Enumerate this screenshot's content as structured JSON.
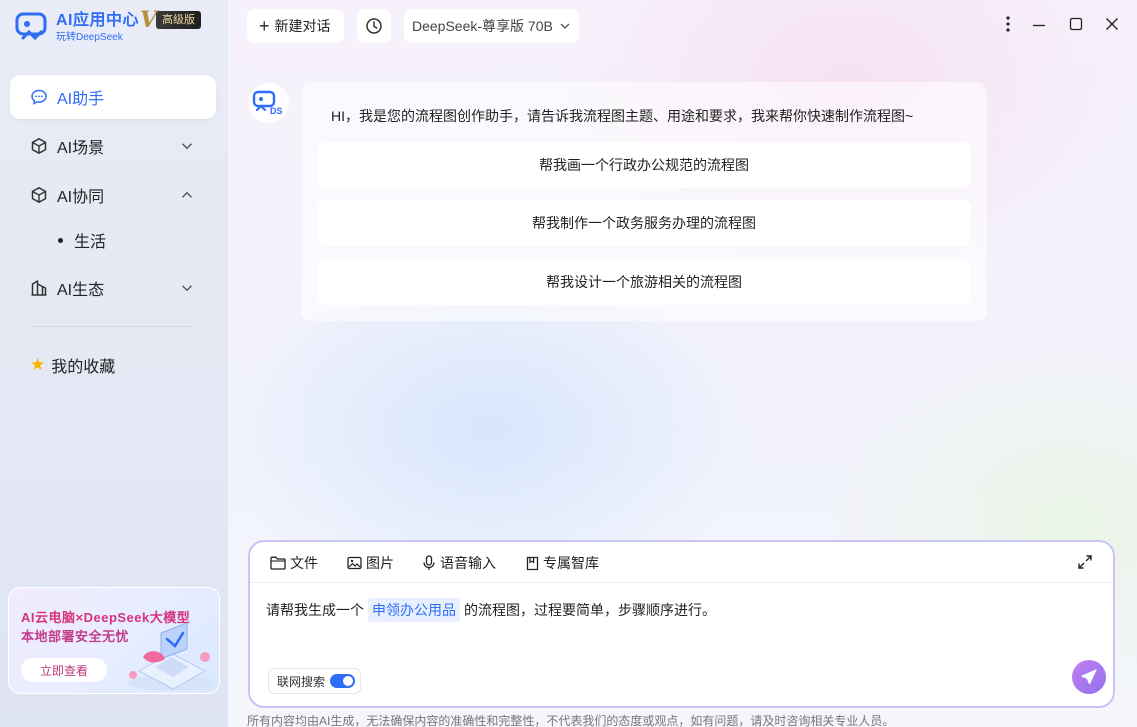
{
  "app": {
    "logo_title": "AI应用中心",
    "logo_subtitle": "玩转DeepSeek",
    "vip_letter": "V",
    "vip_label": "高级版"
  },
  "sidebar": {
    "items": [
      {
        "label": "AI助手",
        "active": true
      },
      {
        "label": "AI场景"
      },
      {
        "label": "AI协同"
      },
      {
        "label": "AI生态"
      }
    ],
    "sub_items": [
      "生活"
    ],
    "favorites_label": "我的收藏",
    "favorites_icon": "★"
  },
  "promo": {
    "line1": "AI云电脑×DeepSeek大模型",
    "line2": "本地部署安全无忧",
    "button": "立即查看"
  },
  "topbar": {
    "new_chat_icon": "+",
    "new_chat_label": "新建对话",
    "model": "DeepSeek-尊享版 70B"
  },
  "chat": {
    "greeting": "HI，我是您的流程图创作助手，请告诉我流程图主题、用途和要求，我来帮你快速制作流程图~",
    "suggestions": [
      "帮我画一个行政办公规范的流程图",
      "帮我制作一个政务服务办理的流程图",
      "帮我设计一个旅游相关的流程图"
    ]
  },
  "composer": {
    "tools": {
      "file": "文件",
      "image": "图片",
      "voice": "语音输入",
      "kb": "专属智库"
    },
    "prompt_before": "请帮我生成一个",
    "prompt_chip": "申领办公用品",
    "prompt_after": "的流程图，过程要简单，步骤顺序进行。",
    "web_search_label": "联网搜索",
    "web_search_on": true
  },
  "footer": {
    "disclaimer": "所有内容均由AI生成，无法确保内容的准确性和完整性，不代表我们的态度或观点，如有问题，请及时咨询相关专业人员。"
  },
  "colors": {
    "accent": "#2f6df6",
    "send_start": "#c37ff0",
    "send_end": "#8f72ef",
    "composer_border": "#c9c4f4"
  }
}
